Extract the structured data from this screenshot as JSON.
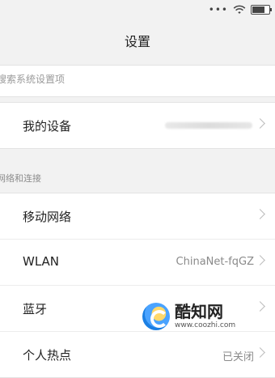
{
  "status_bar": {
    "signal_dots": "•••",
    "wifi_icon": "wifi-icon",
    "battery_icon": "battery-icon",
    "battery_level": 0.75
  },
  "header": {
    "title": "设置"
  },
  "search": {
    "placeholder": "搜索系统设置项"
  },
  "my_device": {
    "label": "我的设备",
    "chevron_icon": "chevron-right-icon"
  },
  "section": {
    "label": "网络和连接"
  },
  "network_items": [
    {
      "label": "移动网络",
      "value": "",
      "chevron_icon": "chevron-right-icon"
    },
    {
      "label": "WLAN",
      "value": "ChinaNet-fqGZ",
      "chevron_icon": "chevron-right-icon"
    },
    {
      "label": "蓝牙",
      "value": "",
      "chevron_icon": "chevron-right-icon"
    },
    {
      "label": "个人热点",
      "value": "已关闭",
      "chevron_icon": "chevron-right-icon"
    }
  ],
  "watermark": {
    "name": "酷知网",
    "url": "www.coozhi.com"
  },
  "colors": {
    "background": "#f2f2f2",
    "card": "#ffffff",
    "text": "#222222",
    "muted": "#8a8a8a"
  }
}
